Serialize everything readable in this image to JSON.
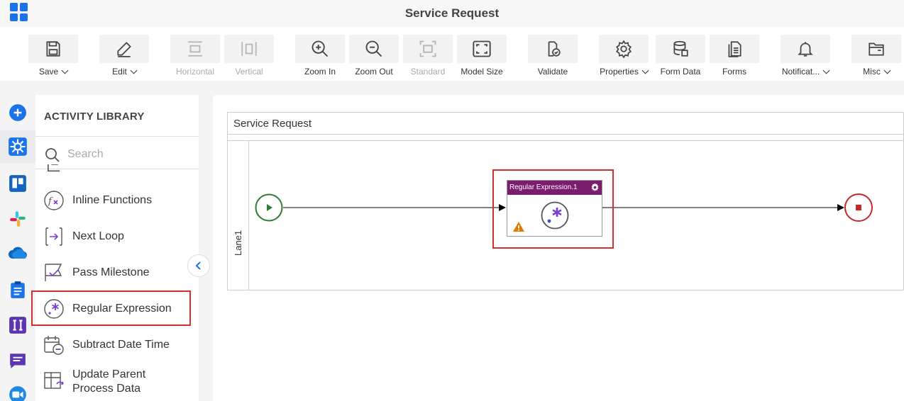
{
  "window": {
    "title": "Service Request"
  },
  "toolbar": {
    "save": "Save",
    "edit": "Edit",
    "horizontal": "Horizontal",
    "vertical": "Vertical",
    "zoom_in": "Zoom In",
    "zoom_out": "Zoom Out",
    "standard": "Standard",
    "model_size": "Model Size",
    "validate": "Validate",
    "properties": "Properties",
    "form_data": "Form Data",
    "forms": "Forms",
    "notifications": "Notificat...",
    "misc": "Misc"
  },
  "library": {
    "heading": "ACTIVITY LIBRARY",
    "search_placeholder": "Search",
    "items": [
      {
        "label": "Inline Functions"
      },
      {
        "label": "Next Loop"
      },
      {
        "label": "Pass Milestone"
      },
      {
        "label": "Regular Expression"
      },
      {
        "label": "Subtract Date Time"
      },
      {
        "label_line1": "Update Parent",
        "label_line2": "Process Data"
      }
    ]
  },
  "canvas": {
    "pool_title": "Service Request",
    "lane_name": "Lane1",
    "task_title": "Regular Expression.1"
  },
  "colors": {
    "accent": "#1a73e8",
    "task_header": "#7b1c6e",
    "start_event": "#2e7d32",
    "end_event": "#c62828",
    "highlight": "#d32f2f",
    "warning": "#e07b00"
  }
}
